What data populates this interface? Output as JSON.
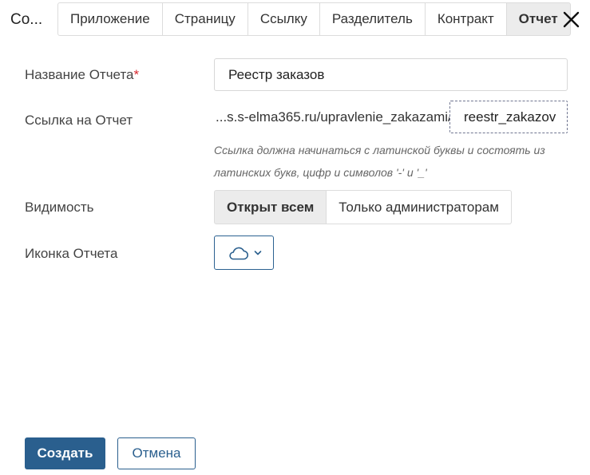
{
  "dialog": {
    "title": "Со..."
  },
  "tabs": [
    {
      "label": "Приложение"
    },
    {
      "label": "Страницу"
    },
    {
      "label": "Ссылку"
    },
    {
      "label": "Разделитель"
    },
    {
      "label": "Контракт"
    },
    {
      "label": "Отчет",
      "active": true
    }
  ],
  "close_icon": "close-icon",
  "form": {
    "name": {
      "label": "Название Отчета",
      "required_mark": "*",
      "value": "Реестр заказов"
    },
    "link": {
      "label": "Ссылка на Отчет",
      "prefix": "...s.s-elma365.ru/upravlenie_zakazami/",
      "value": "reestr_zakazov",
      "hint": "Ссылка должна начинаться с латинской буквы и состоять из латинских букв, цифр и символов '-' и '_'"
    },
    "visibility": {
      "label": "Видимость",
      "options": [
        "Открыт всем",
        "Только администраторам"
      ],
      "selected": "Открыт всем"
    },
    "icon": {
      "label": "Иконка Отчета",
      "selected_icon": "cloud-icon"
    }
  },
  "actions": {
    "create_label": "Создать",
    "cancel_label": "Отмена"
  },
  "colors": {
    "primary": "#2a5f8e",
    "required": "#d8282f",
    "active_tab_bg": "#ececec"
  }
}
